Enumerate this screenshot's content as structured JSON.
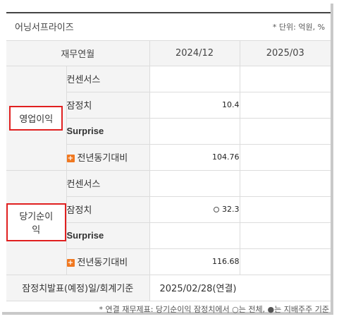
{
  "header": {
    "title": "어닝서프라이즈",
    "unit": "* 단위: 억원, %"
  },
  "columns": {
    "label": "재무연월",
    "col1": "2024/12",
    "col2": "2025/03"
  },
  "groups": [
    {
      "label": "영업이익",
      "rows": [
        {
          "label": "컨센서스",
          "v1": "",
          "v2": ""
        },
        {
          "label": "잠정치",
          "v1": "10.4",
          "v2": ""
        },
        {
          "label": "Surprise",
          "v1": "",
          "v2": ""
        },
        {
          "label": "전년동기대비",
          "v1": "104.76",
          "v2": "",
          "icon": "plus-icon"
        }
      ]
    },
    {
      "label": "당기순이익",
      "rows": [
        {
          "label": "컨센서스",
          "v1": "",
          "v2": ""
        },
        {
          "label": "잠정치",
          "v1": "32.3",
          "v2": "",
          "marker": "circle-icon"
        },
        {
          "label": "Surprise",
          "v1": "",
          "v2": ""
        },
        {
          "label": "전년동기대비",
          "v1": "116.68",
          "v2": "",
          "icon": "plus-icon"
        }
      ]
    }
  ],
  "footer_row": {
    "label": "잠정치발표(예정)일/회계기준",
    "value": "2025/02/28(연결)"
  },
  "note": "* 연결 재무제표: 당기순이익 잠정치에서 ○는 전체, ●는 지배주주 기준",
  "colors": {
    "highlight_border": "#e02020",
    "plus_icon": "#f07820",
    "header_bg": "#f4f4f4"
  }
}
